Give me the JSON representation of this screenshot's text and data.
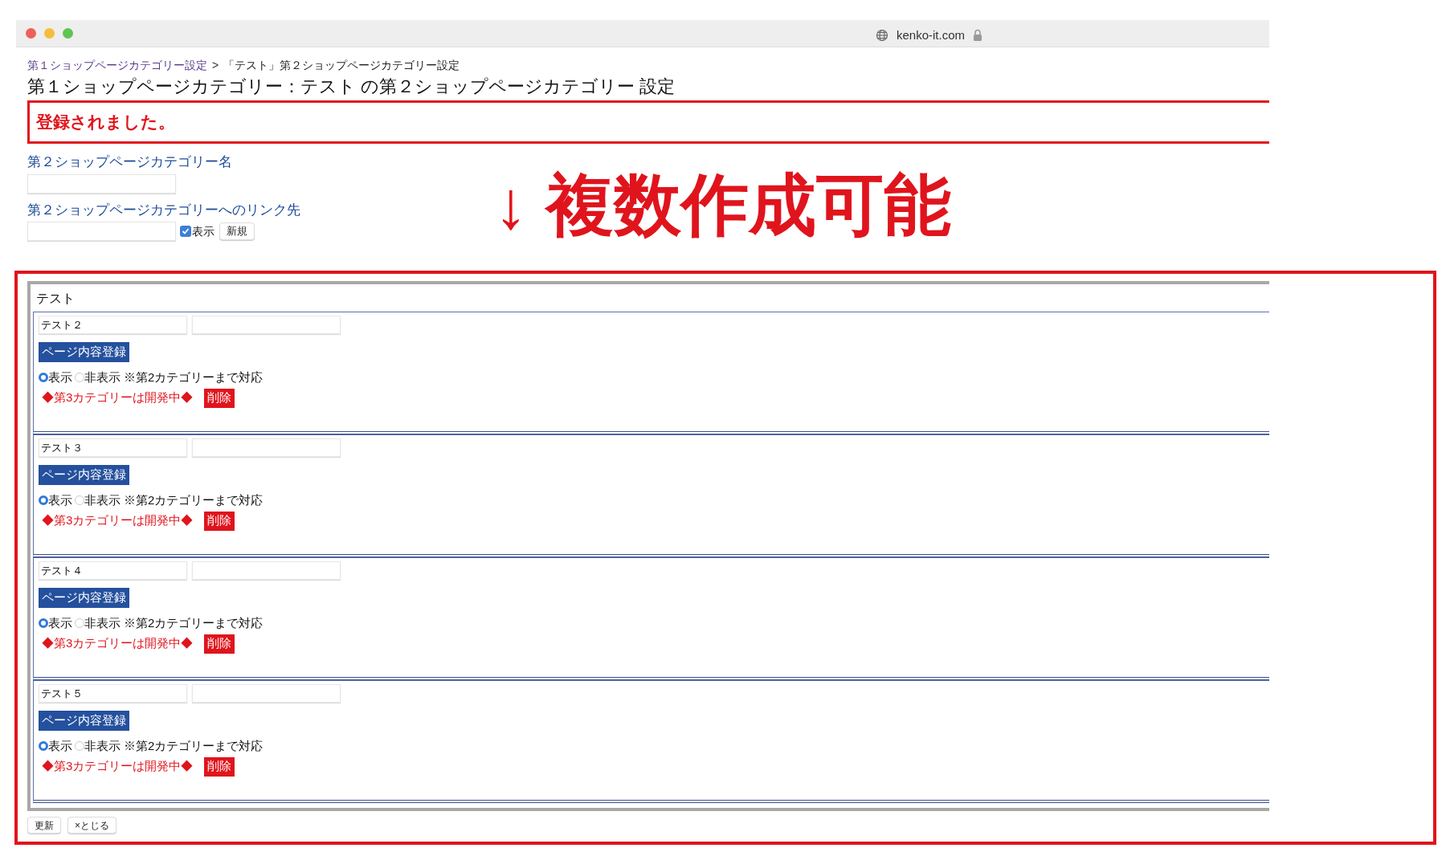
{
  "browser": {
    "url": "kenko-it.com"
  },
  "breadcrumb": {
    "link": "第１ショップページカテゴリー設定",
    "separator": ">",
    "current": "「テスト」第２ショップページカテゴリー設定"
  },
  "title": "第１ショップページカテゴリー：テスト の第２ショップページカテゴリー 設定",
  "message": "登録されました。",
  "form": {
    "name_label": "第２ショップページカテゴリー名",
    "link_label": "第２ショップページカテゴリーへのリンク先",
    "visible_checkbox": {
      "label": "表示",
      "checked": true
    },
    "new_button": "新規"
  },
  "annotation": "↓ 複数作成可能",
  "category": {
    "name": "テスト",
    "subcategories": [
      {
        "name": "テスト２",
        "register_button": "ページ内容登録",
        "radios": [
          {
            "label": "表示",
            "selected": true
          },
          {
            "label": "非表示",
            "selected": false
          }
        ],
        "note": "※第2カテゴリーまで対応",
        "dev_notice": "◆第3カテゴリーは開発中◆",
        "delete_button": "削除"
      },
      {
        "name": "テスト３",
        "register_button": "ページ内容登録",
        "radios": [
          {
            "label": "表示",
            "selected": true
          },
          {
            "label": "非表示",
            "selected": false
          }
        ],
        "note": "※第2カテゴリーまで対応",
        "dev_notice": "◆第3カテゴリーは開発中◆",
        "delete_button": "削除"
      },
      {
        "name": "テスト４",
        "register_button": "ページ内容登録",
        "radios": [
          {
            "label": "表示",
            "selected": true
          },
          {
            "label": "非表示",
            "selected": false
          }
        ],
        "note": "※第2カテゴリーまで対応",
        "dev_notice": "◆第3カテゴリーは開発中◆",
        "delete_button": "削除"
      },
      {
        "name": "テスト５",
        "register_button": "ページ内容登録",
        "radios": [
          {
            "label": "表示",
            "selected": true
          },
          {
            "label": "非表示",
            "selected": false
          }
        ],
        "note": "※第2カテゴリーまで対応",
        "dev_notice": "◆第3カテゴリーは開発中◆",
        "delete_button": "削除"
      }
    ]
  },
  "footer_buttons": [
    "更新",
    "×とじる"
  ]
}
